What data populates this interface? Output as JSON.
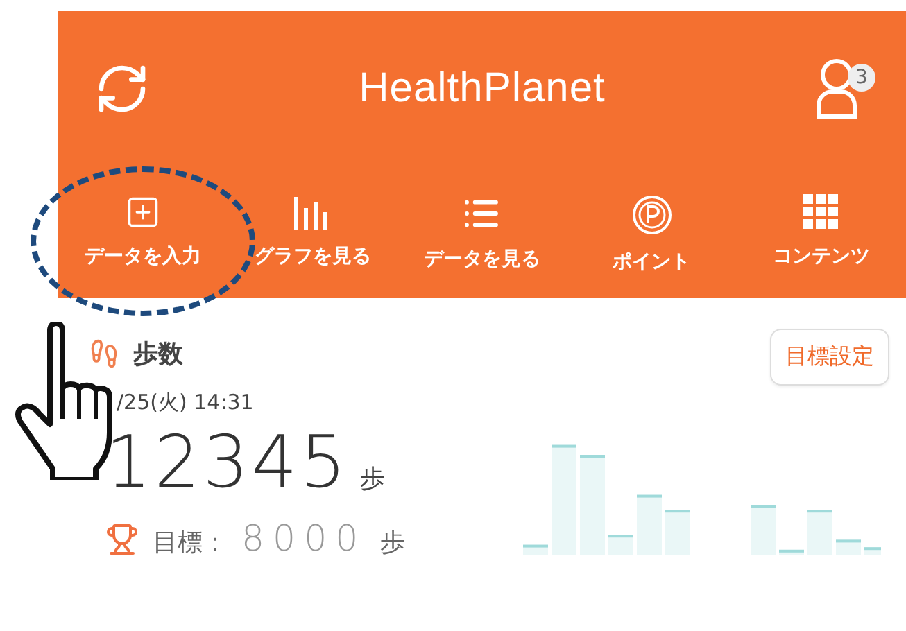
{
  "header": {
    "logo": "HealthPlanet",
    "badge": "3"
  },
  "nav": [
    {
      "label": "データを入力",
      "kind": "add",
      "highlighted": true
    },
    {
      "label": "グラフを見る",
      "kind": "graph",
      "highlighted": false
    },
    {
      "label": "データを見る",
      "kind": "list",
      "highlighted": false
    },
    {
      "label": "ポイント",
      "kind": "point",
      "highlighted": false
    },
    {
      "label": "コンテンツ",
      "kind": "grid",
      "highlighted": false
    }
  ],
  "steps": {
    "title": "歩数",
    "datetime": "/25(火) 14:31",
    "value": "12345",
    "unit": "歩",
    "goal_label": "目標：",
    "goal_value": "8000",
    "goal_unit": "歩",
    "goal_button": "目標設定"
  }
}
